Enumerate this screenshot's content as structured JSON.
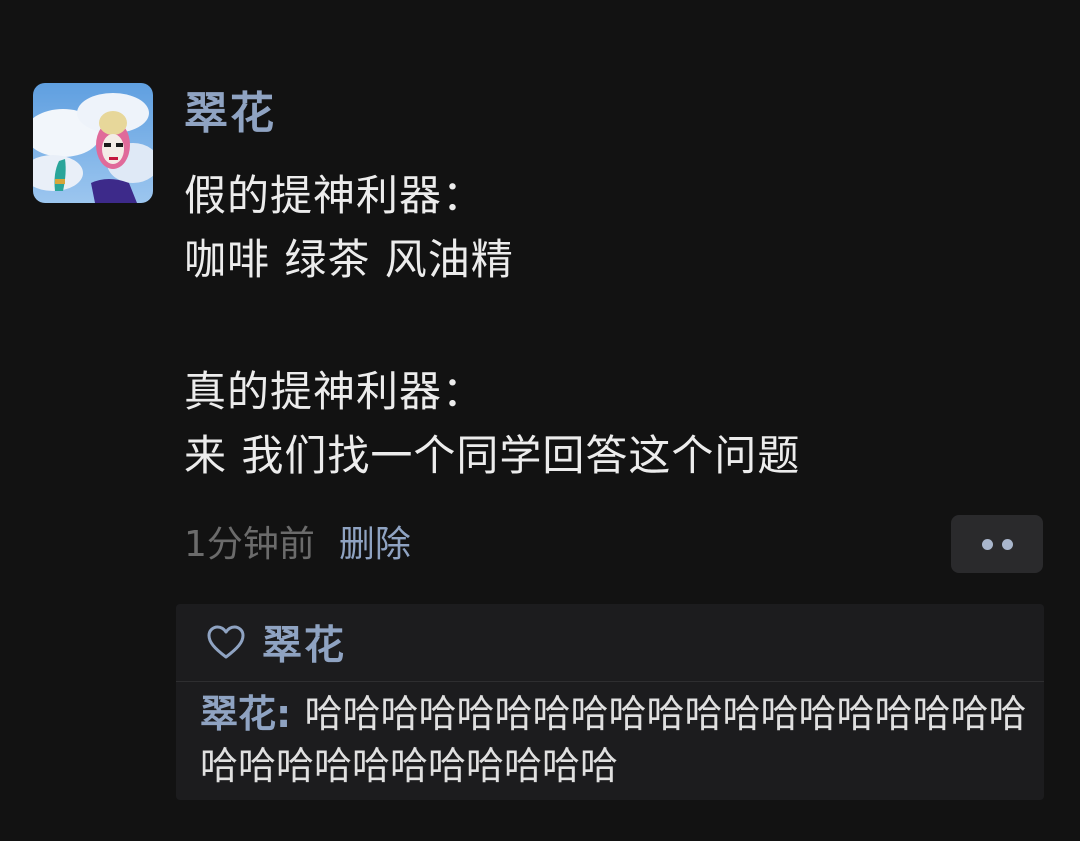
{
  "post": {
    "author": "翠花",
    "lines": [
      "假的提神利器：",
      "咖啡 绿茶 风油精",
      "真的提神利器：",
      "来 我们找一个同学回答这个问题"
    ],
    "time": "1分钟前",
    "delete_label": "删除"
  },
  "likes": {
    "names": "翠花"
  },
  "comments": [
    {
      "author": "翠花",
      "separator": ": ",
      "text": "哈哈哈哈哈哈哈哈哈哈哈哈哈哈哈哈哈哈哈哈哈哈哈哈哈哈哈哈哈哈"
    }
  ],
  "icons": {
    "like": "heart-outline-icon",
    "more": "more-dots-icon"
  },
  "colors": {
    "background": "#121212",
    "name_link": "#8fa3c2",
    "body_text": "#ececec",
    "muted_text": "#6b6b6b",
    "panel": "#1c1c1e"
  }
}
